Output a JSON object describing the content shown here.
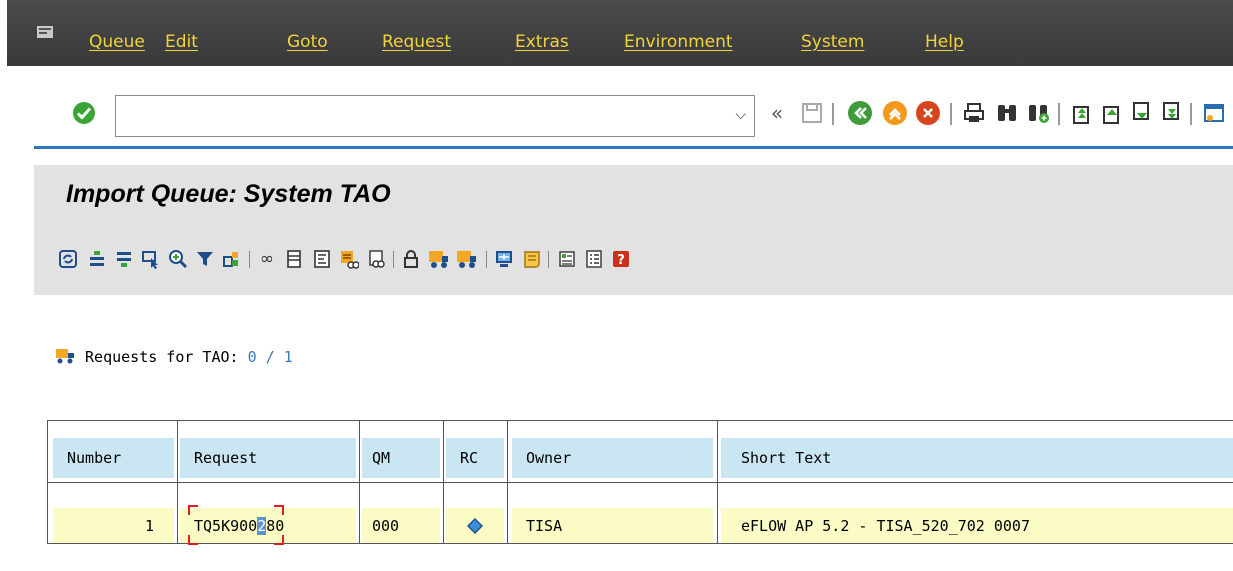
{
  "menubar": {
    "items": [
      "Queue",
      "Edit",
      "Goto",
      "Request",
      "Extras",
      "Environment",
      "System",
      "Help"
    ]
  },
  "command_field": {
    "value": ""
  },
  "toolbar_icons": [
    "enter-check-icon",
    "save-icon",
    "back-icon",
    "exit-icon",
    "cancel-icon",
    "print-icon",
    "find-icon",
    "find-next-icon",
    "first-page-icon",
    "previous-page-icon",
    "next-page-icon",
    "last-page-icon",
    "create-session-icon",
    "shortcut-icon",
    "help-icon",
    "customize-layout-icon"
  ],
  "page_title": "Import Queue: System TAO",
  "app_toolbar_icons": [
    "refresh-icon",
    "sort-ascending-icon",
    "sort-descending-icon",
    "select-icon",
    "zoom-details-icon",
    "filter-icon",
    "transport-tools-icon",
    "display-object-list-icon",
    "document-icon",
    "text-icon",
    "import-request-icon",
    "request-display-icon",
    "lock-icon",
    "import-all-icon",
    "import-request-truck-icon",
    "monitor-icon",
    "log-icon",
    "legend-icon",
    "list-icon",
    "info-icon"
  ],
  "requests": {
    "label": "Requests for TAO:",
    "count": "0 / 1"
  },
  "table": {
    "columns": [
      "Number",
      "Request",
      "QM",
      "RC",
      "Owner",
      "Short Text"
    ],
    "rows": [
      {
        "number": "1",
        "request_pre": "TQ5K900",
        "request_sel": "2",
        "request_post": "80",
        "qm": "000",
        "rc_icon": "diamond-status-icon",
        "owner": "TISA",
        "short_text": "eFLOW AP 5.2 - TISA_520_702 0007"
      }
    ]
  },
  "colors": {
    "menu_text": "#f2d43a",
    "header_bg": "#c9e6f2",
    "row_bg": "#fbfbc6",
    "accent_line": "#2a78c2"
  }
}
